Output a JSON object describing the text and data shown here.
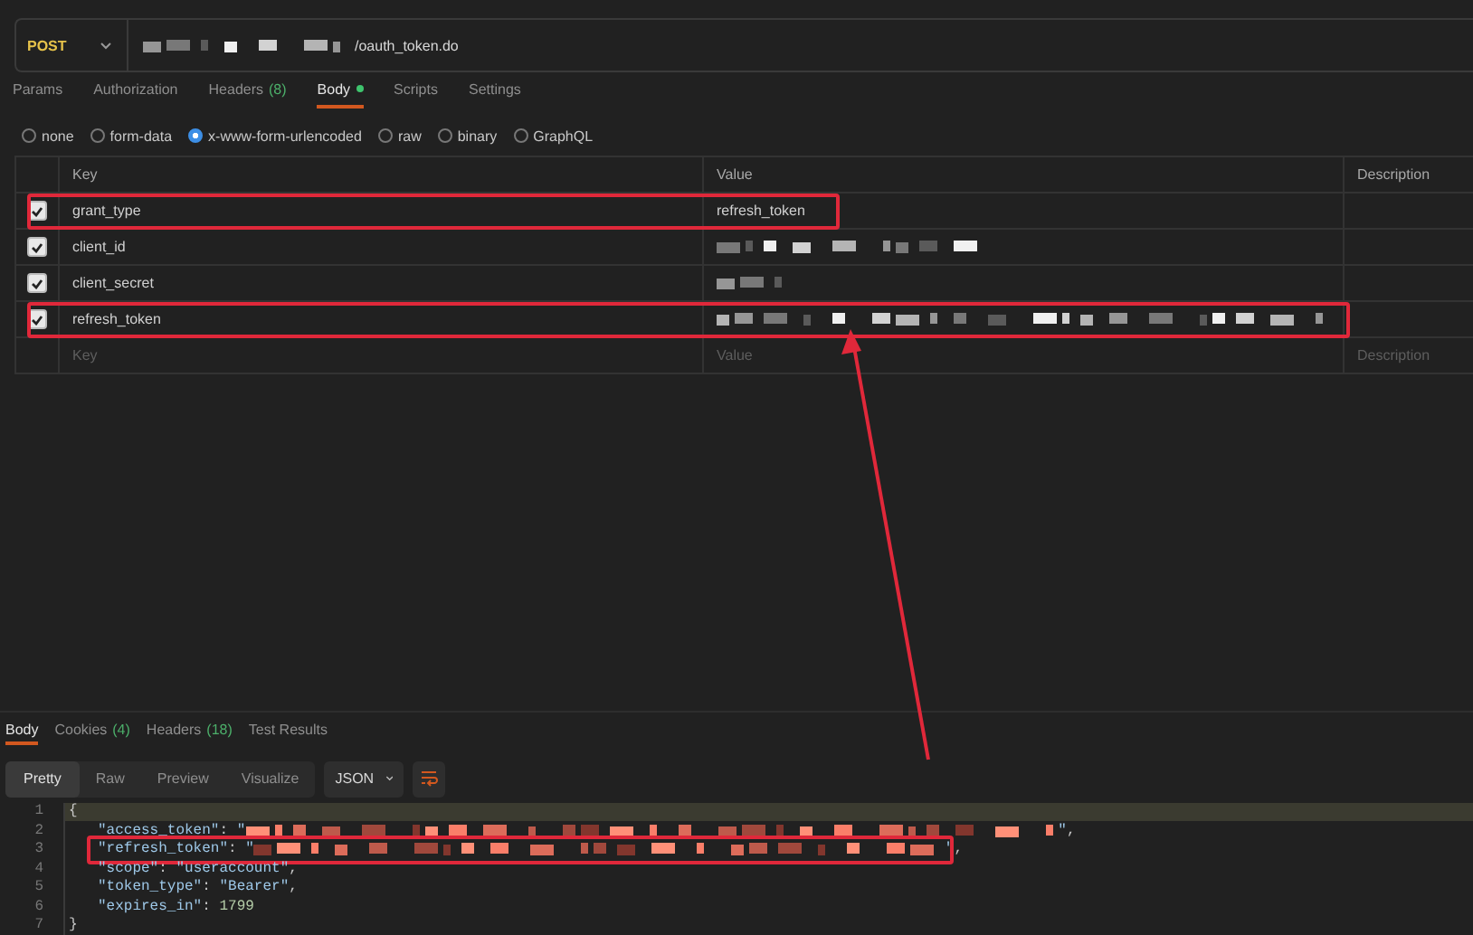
{
  "request": {
    "method": "POST",
    "url_redacted": true,
    "url": "/oauth_token.do"
  },
  "tabs": [
    {
      "label": "Params",
      "dot": false,
      "selected": false
    },
    {
      "label": "Authorization",
      "dot": false,
      "selected": false
    },
    {
      "label": "Headers",
      "badge": "(8)",
      "dot": false,
      "selected": false
    },
    {
      "label": "Body",
      "dot": true,
      "selected": true
    },
    {
      "label": "Scripts",
      "dot": false,
      "selected": false
    },
    {
      "label": "Settings",
      "dot": false,
      "selected": false
    }
  ],
  "body_types": [
    {
      "label": "none",
      "selected": false
    },
    {
      "label": "form-data",
      "selected": false
    },
    {
      "label": "x-www-form-urlencoded",
      "selected": true
    },
    {
      "label": "raw",
      "selected": false
    },
    {
      "label": "binary",
      "selected": false
    },
    {
      "label": "GraphQL",
      "selected": false
    }
  ],
  "table": {
    "columns": [
      "Key",
      "Value",
      "Description"
    ],
    "rows": [
      {
        "key": "grant_type",
        "value": "refresh_token",
        "kind": "text",
        "checked": true,
        "highlighted": true
      },
      {
        "key": "client_id",
        "kind": "redacted",
        "checked": true,
        "highlighted": false
      },
      {
        "key": "client_secret",
        "kind": "redacted",
        "checked": true,
        "highlighted": false
      },
      {
        "key": "refresh_token",
        "kind": "redacted",
        "checked": true,
        "highlighted": true
      }
    ],
    "placeholder_row": {
      "key": "Key",
      "value": "Value",
      "description": "Description"
    }
  },
  "response": {
    "tabs": [
      {
        "label": "Body",
        "selected": true
      },
      {
        "label": "Cookies",
        "badge": "(4)",
        "selected": false
      },
      {
        "label": "Headers",
        "badge": "(18)",
        "selected": false
      },
      {
        "label": "Test Results",
        "selected": false
      }
    ],
    "views": [
      {
        "label": "Pretty",
        "selected": true
      },
      {
        "label": "Raw",
        "selected": false
      },
      {
        "label": "Preview",
        "selected": false
      },
      {
        "label": "Visualize",
        "selected": false
      }
    ],
    "format": "JSON",
    "lines": [
      {
        "number": "1",
        "tokens": [
          {
            "kind": "punct",
            "text": "{"
          }
        ],
        "current": true,
        "highlighted": false
      },
      {
        "number": "2",
        "tokens": [
          {
            "kind": "key",
            "text": "\"access_token\""
          },
          {
            "kind": "punct",
            "text": ": "
          },
          {
            "kind": "string",
            "text": "\""
          },
          {
            "kind": "redacted"
          },
          {
            "kind": "string",
            "text": "\""
          },
          {
            "kind": "punct",
            "text": ","
          }
        ],
        "current": false,
        "highlighted": false
      },
      {
        "number": "3",
        "tokens": [
          {
            "kind": "key",
            "text": "\"refresh_token\""
          },
          {
            "kind": "punct",
            "text": ": "
          },
          {
            "kind": "string",
            "text": "\""
          },
          {
            "kind": "redacted"
          },
          {
            "kind": "string",
            "text": "\""
          },
          {
            "kind": "punct",
            "text": ","
          }
        ],
        "current": false,
        "highlighted": true
      },
      {
        "number": "4",
        "tokens": [
          {
            "kind": "key",
            "text": "\"scope\""
          },
          {
            "kind": "punct",
            "text": ": "
          },
          {
            "kind": "string",
            "text": "\"useraccount\""
          },
          {
            "kind": "punct",
            "text": ","
          }
        ],
        "current": false,
        "highlighted": false
      },
      {
        "number": "5",
        "tokens": [
          {
            "kind": "key",
            "text": "\"token_type\""
          },
          {
            "kind": "punct",
            "text": ": "
          },
          {
            "kind": "string",
            "text": "\"Bearer\""
          },
          {
            "kind": "punct",
            "text": ","
          }
        ],
        "current": false,
        "highlighted": false
      },
      {
        "number": "6",
        "tokens": [
          {
            "kind": "key",
            "text": "\"expires_in\""
          },
          {
            "kind": "punct",
            "text": ": "
          },
          {
            "kind": "number",
            "text": "1799"
          }
        ],
        "current": false,
        "highlighted": false
      },
      {
        "number": "7",
        "tokens": [
          {
            "kind": "punct",
            "text": "}"
          }
        ],
        "current": false,
        "highlighted": false
      }
    ]
  }
}
